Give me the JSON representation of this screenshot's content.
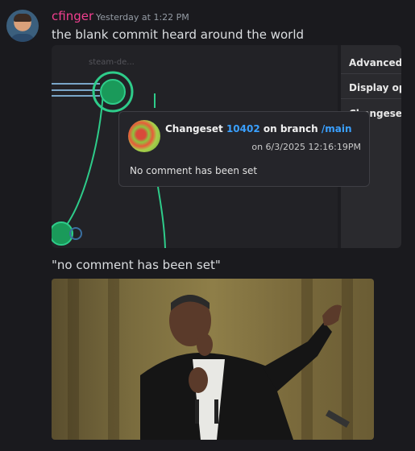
{
  "message": {
    "username": "cfinger",
    "timestamp": "Yesterday at 1:22 PM",
    "text": "the blank commit heard around the world",
    "caption": "\"no comment has been set\""
  },
  "screenshot": {
    "branch_label": "steam-de...",
    "side_panel": {
      "items": [
        "Advanced ",
        "Display opt",
        "Changeset"
      ]
    },
    "popup": {
      "title_prefix": "Changeset",
      "changeset_number": "10402",
      "title_mid": "on branch",
      "branch": "/main",
      "date": "on 6/3/2025 12:16:19PM",
      "comment": "No comment has been set"
    }
  },
  "icons": {
    "avatar": "user-avatar",
    "popup_thumb": "changeset-author-avatar",
    "meme": "meme-photo"
  },
  "colors": {
    "background": "#1a1a1e",
    "username": "#f23f8f",
    "accent_blue": "#3aa0ff",
    "graph_green": "#2ecc8a"
  }
}
